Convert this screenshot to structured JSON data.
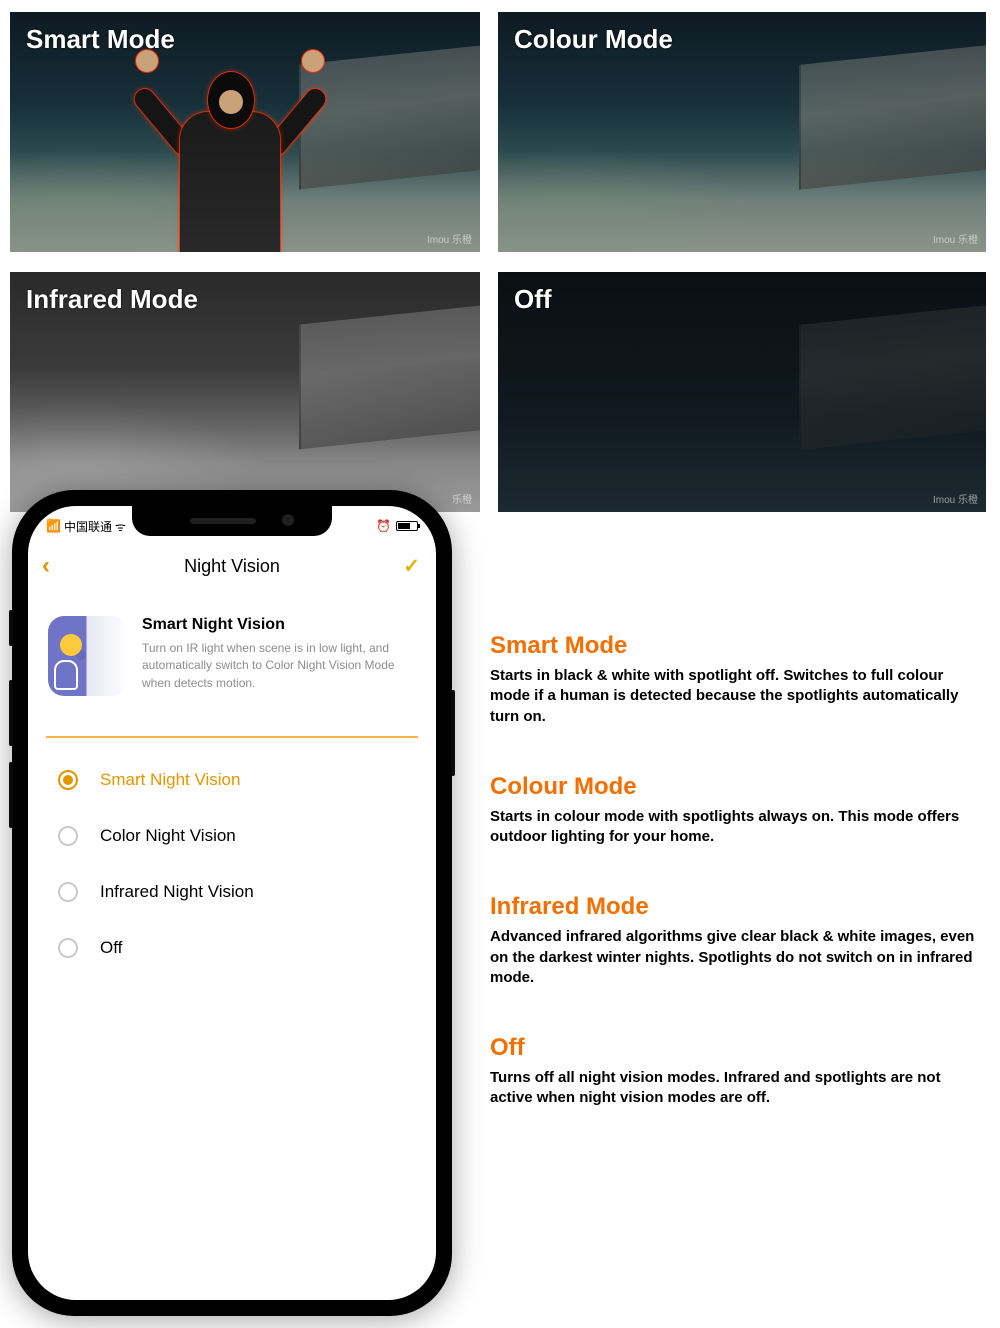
{
  "grid": {
    "smart": {
      "label": "Smart Mode",
      "watermark": "Imou 乐橙"
    },
    "colour": {
      "label": "Colour Mode",
      "watermark": "Imou 乐橙"
    },
    "infrared": {
      "label": "Infrared Mode",
      "watermark": "乐橙"
    },
    "off": {
      "label": "Off",
      "watermark": "Imou 乐橙"
    }
  },
  "phone": {
    "carrier": "中国联通",
    "title": "Night Vision",
    "feature": {
      "title": "Smart Night Vision",
      "desc": "Turn on IR light when scene is in low light, and automatically switch to Color Night Vision Mode when detects motion."
    },
    "options": [
      {
        "label": "Smart Night Vision",
        "selected": true
      },
      {
        "label": "Color Night Vision",
        "selected": false
      },
      {
        "label": "Infrared Night Vision",
        "selected": false
      },
      {
        "label": "Off",
        "selected": false
      }
    ]
  },
  "descriptions": [
    {
      "title": "Smart Mode",
      "body": "Starts in black & white with spotlight off. Switches to full colour mode if a human is detected because the spotlights automatically turn on."
    },
    {
      "title": "Colour Mode",
      "body": "Starts in colour mode with spotlights always on. This mode offers outdoor lighting for your home."
    },
    {
      "title": "Infrared Mode",
      "body": "Advanced infrared algorithms give clear black & white images, even on the darkest winter nights. Spotlights do not switch on in infrared mode."
    },
    {
      "title": "Off",
      "body": "Turns off all night vision modes. Infrared and spotlights are not active when night vision modes are off."
    }
  ],
  "colors": {
    "accent": "#f36f00"
  }
}
